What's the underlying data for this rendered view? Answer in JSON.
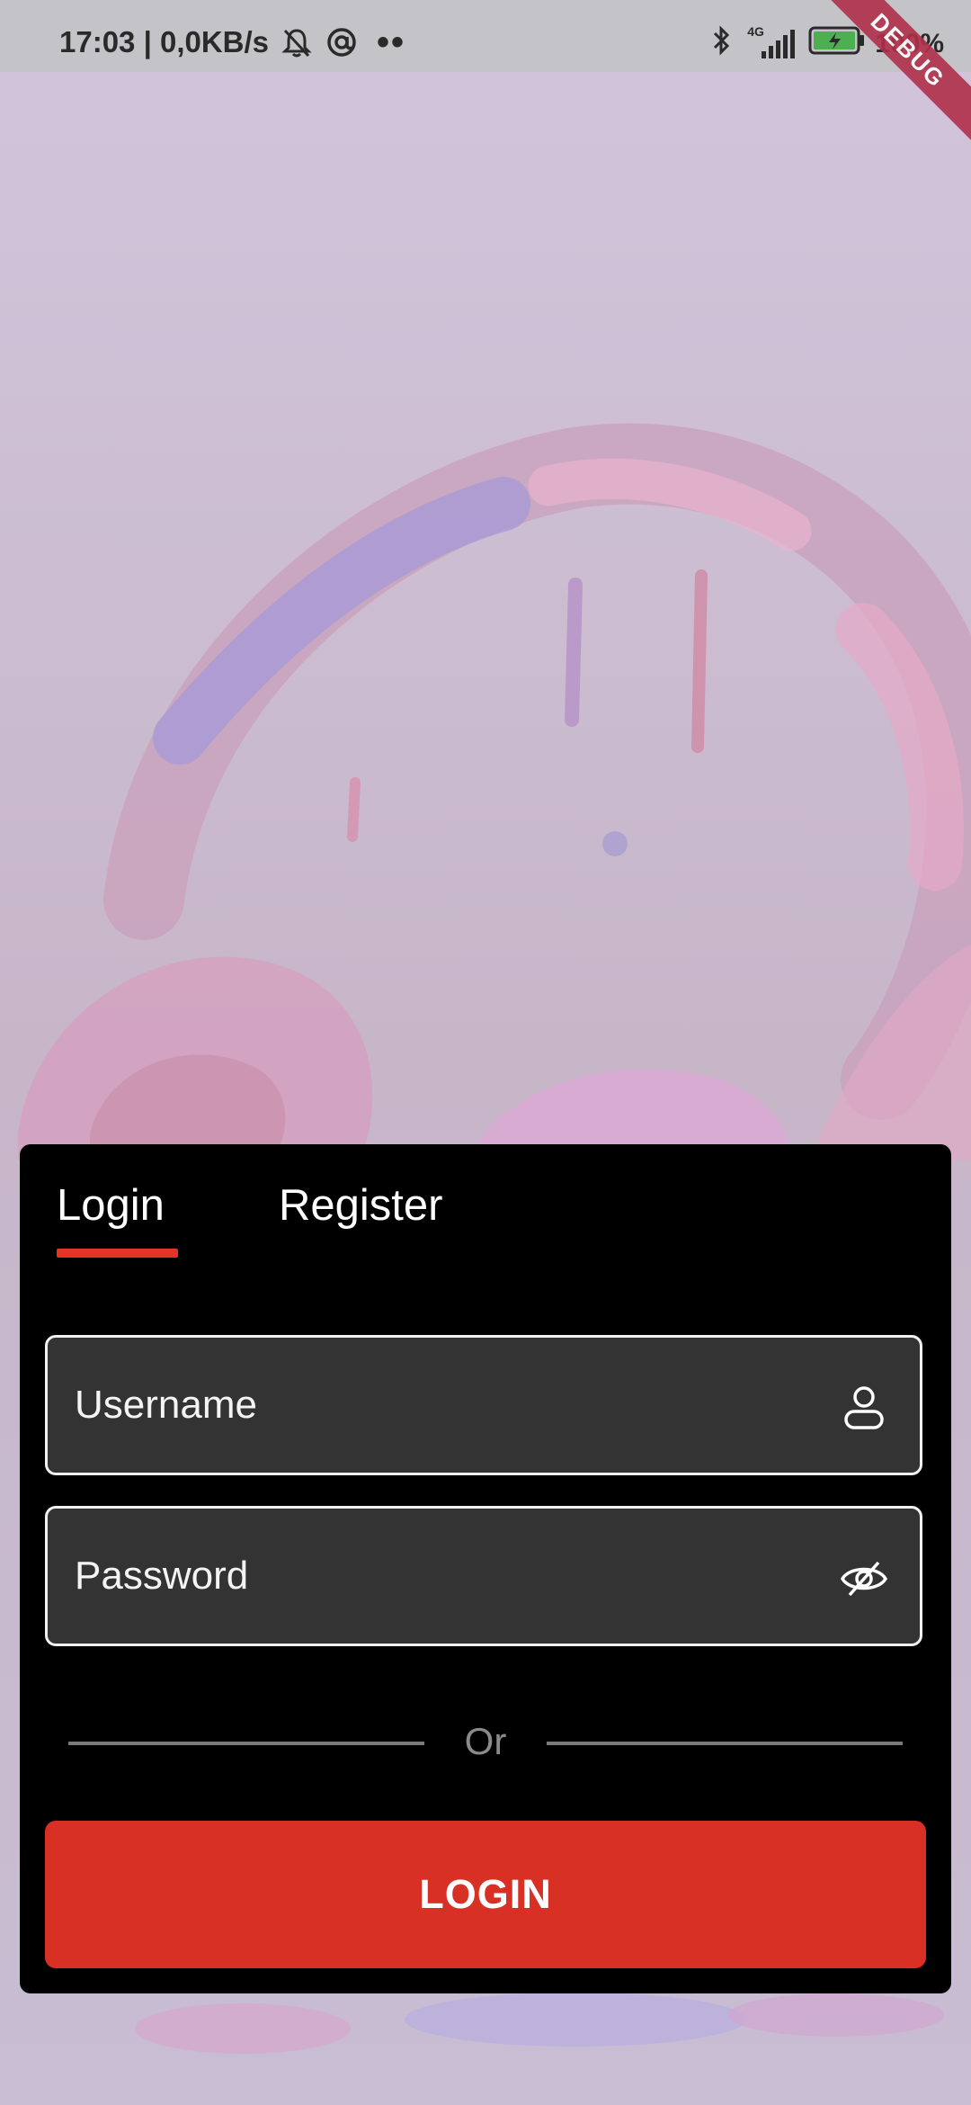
{
  "status_bar": {
    "time_and_speed": "17:03 | 0,0KB/s",
    "more_dots": "••",
    "network_type": "4G",
    "battery_percent": "100%",
    "icons": [
      "mute-bell-icon",
      "at-sign-icon",
      "bluetooth-icon",
      "signal-icon",
      "battery-charging-icon"
    ]
  },
  "debug_banner": "DEBUG",
  "auth": {
    "tabs": [
      {
        "label": "Login",
        "selected": true
      },
      {
        "label": "Register",
        "selected": false
      }
    ],
    "username_placeholder": "Username",
    "password_placeholder": "Password",
    "divider_text": "Or",
    "login_button_label": "LOGIN"
  },
  "colors": {
    "accent": "#d93026",
    "tab_indicator": "#e0352b",
    "card_background": "#000000",
    "field_background": "#333333"
  }
}
